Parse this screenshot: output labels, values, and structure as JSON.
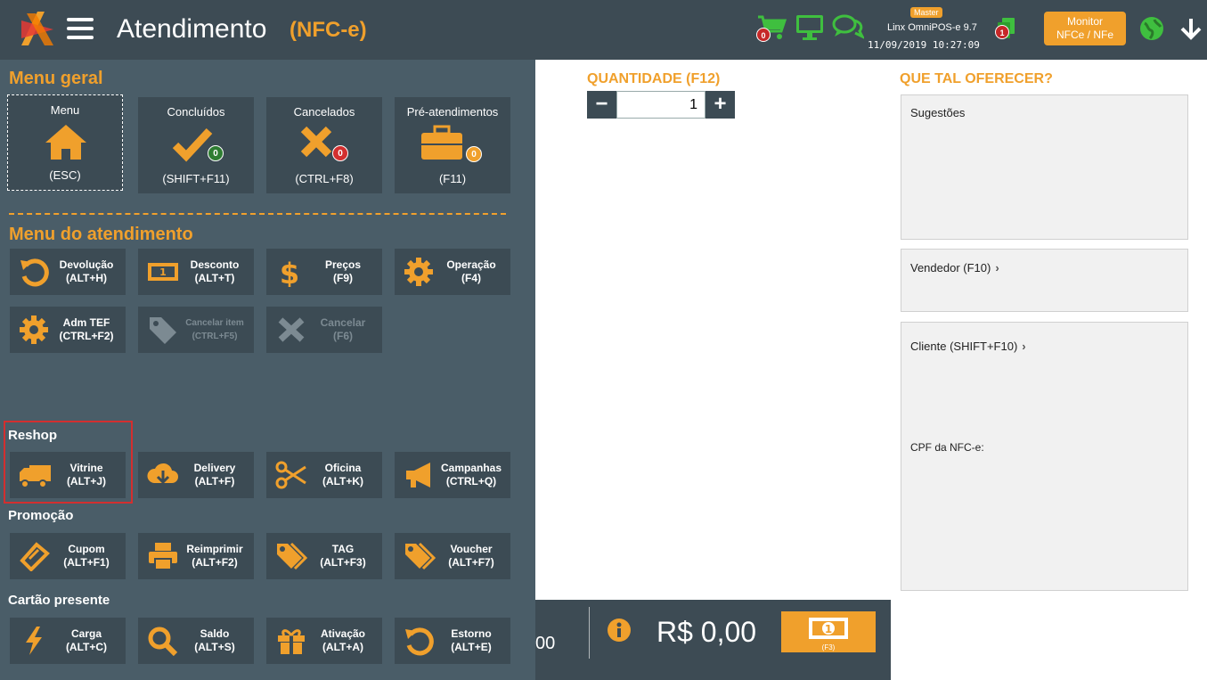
{
  "header": {
    "title": "Atendimento",
    "subtitle": "(NFC-e)",
    "cart_badge": "0",
    "copy_badge": "1",
    "master_label": "Master",
    "system_name": "Linx OmniPOS-e  9.7",
    "datetime": "11/09/2019 10:27:09",
    "monitor_btn_line1": "Monitor",
    "monitor_btn_line2": "NFCe / NFe"
  },
  "menu_geral": {
    "title": "Menu geral",
    "tiles": [
      {
        "top": "Menu",
        "bottom": "(ESC)",
        "icon": "home-icon"
      },
      {
        "top": "Concluídos",
        "bottom": "(SHIFT+F11)",
        "badge": "0",
        "icon": "check-icon"
      },
      {
        "top": "Cancelados",
        "bottom": "(CTRL+F8)",
        "badge": "0",
        "icon": "x-icon"
      },
      {
        "top": "Pré-atendimentos",
        "bottom": "(F11)",
        "badge": "0",
        "icon": "briefcase-icon"
      }
    ]
  },
  "menu_atendimento": {
    "title": "Menu do atendimento",
    "tiles": [
      {
        "line1": "Devolução",
        "line2": "(ALT+H)"
      },
      {
        "line1": "Desconto",
        "line2": "(ALT+T)"
      },
      {
        "line1": "Preços",
        "line2": "(F9)"
      },
      {
        "line1": "Operação",
        "line2": "(F4)"
      },
      {
        "line1": "Adm TEF",
        "line2": "(CTRL+F2)"
      },
      {
        "line1": "Cancelar item",
        "line2": "(CTRL+F5)"
      },
      {
        "line1": "Cancelar",
        "line2": "(F6)"
      }
    ]
  },
  "reshop": {
    "title": "Reshop",
    "tiles": [
      {
        "line1": "Vitrine",
        "line2": "(ALT+J)"
      },
      {
        "line1": "Delivery",
        "line2": "(ALT+F)"
      },
      {
        "line1": "Oficina",
        "line2": "(ALT+K)"
      },
      {
        "line1": "Campanhas",
        "line2": "(CTRL+Q)"
      }
    ]
  },
  "promocao": {
    "title": "Promoção",
    "tiles": [
      {
        "line1": "Cupom",
        "line2": "(ALT+F1)"
      },
      {
        "line1": "Reimprimir",
        "line2": "(ALT+F2)"
      },
      {
        "line1": "TAG",
        "line2": "(ALT+F3)"
      },
      {
        "line1": "Voucher",
        "line2": "(ALT+F7)"
      }
    ]
  },
  "cartao": {
    "title": "Cartão presente",
    "tiles": [
      {
        "line1": "Carga",
        "line2": "(ALT+C)"
      },
      {
        "line1": "Saldo",
        "line2": "(ALT+S)"
      },
      {
        "line1": "Ativação",
        "line2": "(ALT+A)"
      },
      {
        "line1": "Estorno",
        "line2": "(ALT+E)"
      }
    ]
  },
  "quantidade": {
    "title": "QUANTIDADE (F12)",
    "value": "1"
  },
  "bottom": {
    "partial_left": "00",
    "total": "R$ 0,00",
    "pay_label": "(F3)"
  },
  "sugestoes": {
    "title": "QUE TAL OFERECER?",
    "box_title": "Sugestões",
    "vendedor": "Vendedor (F10)",
    "cliente": "Cliente (SHIFT+F10)",
    "cpf": "CPF da NFC-e:"
  },
  "colors": {
    "accent": "#f0a02c",
    "header_bg": "#3d4b54",
    "panel_bg": "#4a5d68",
    "tile_bg": "#3c4b54"
  }
}
